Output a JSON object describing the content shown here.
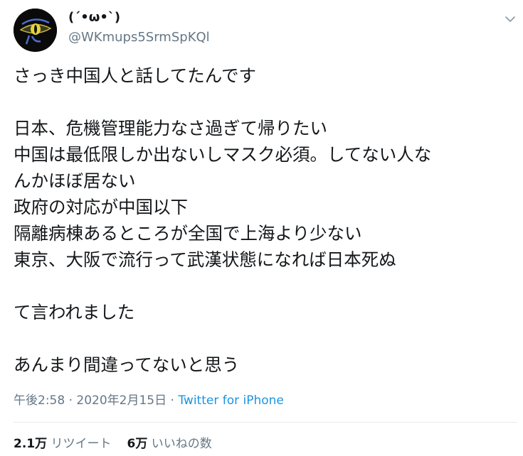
{
  "user": {
    "display_name": "(´•ω•`)",
    "handle": "@WKmups5SrmSpKQl"
  },
  "tweet": {
    "lines": [
      "さっき中国人と話してたんです",
      "",
      "日本、危機管理能力なさ過ぎて帰りたい",
      "中国は最低限しか出ないしマスク必須。してない人な",
      "んかほぼ居ない",
      "政府の対応が中国以下",
      "隔離病棟あるところが全国で上海より少ない",
      "東京、大阪で流行って武漢状態になれば日本死ぬ",
      "",
      "て言われました",
      "",
      "あんまり間違ってないと思う"
    ]
  },
  "meta": {
    "time": "午後2:58",
    "separator1": " · ",
    "date": "2020年2月15日",
    "separator2": " · ",
    "source": "Twitter for iPhone"
  },
  "stats": {
    "retweets_count": "2.1万",
    "retweets_label": "リツイート",
    "likes_count": "6万",
    "likes_label": "いいねの数"
  },
  "colors": {
    "text": "#14171a",
    "secondary": "#657786",
    "link": "#1b95e0",
    "divider": "#e6ecf0"
  },
  "icons": {
    "avatar": "eye-of-horus-avatar",
    "menu": "chevron-down-icon"
  }
}
